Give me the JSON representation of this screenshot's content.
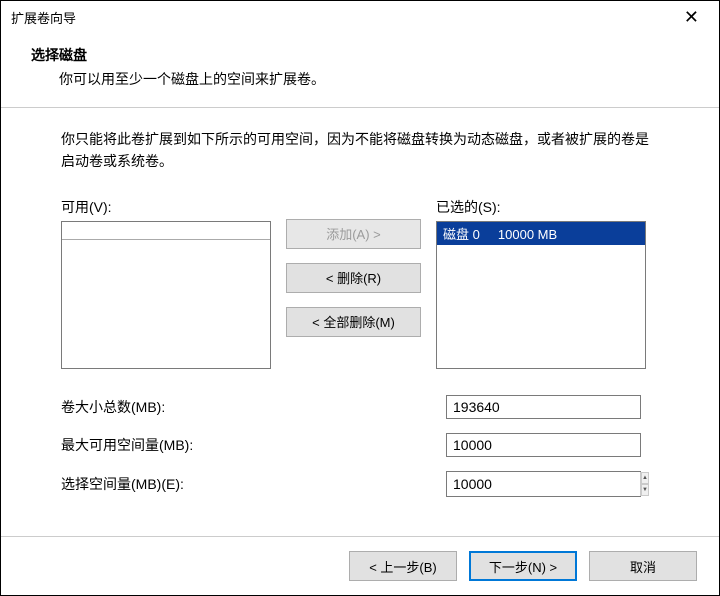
{
  "titlebar": {
    "title": "扩展卷向导"
  },
  "header": {
    "title": "选择磁盘",
    "subtitle": "你可以用至少一个磁盘上的空间来扩展卷。"
  },
  "intro": "你只能将此卷扩展到如下所示的可用空间，因为不能将磁盘转换为动态磁盘，或者被扩展的卷是启动卷或系统卷。",
  "available": {
    "label": "可用(V):"
  },
  "selected": {
    "label": "已选的(S):",
    "item": "磁盘 0     10000 MB"
  },
  "buttons": {
    "add": "添加(A) >",
    "remove": "< 删除(R)",
    "removeAll": "< 全部删除(M)"
  },
  "fields": {
    "totalSize": {
      "label": "卷大小总数(MB):",
      "value": "193640"
    },
    "maxAvail": {
      "label": "最大可用空间量(MB):",
      "value": "10000"
    },
    "selectSize": {
      "label": "选择空间量(MB)(E):",
      "value": "10000"
    }
  },
  "footer": {
    "back": "< 上一步(B)",
    "next": "下一步(N) >",
    "cancel": "取消"
  }
}
